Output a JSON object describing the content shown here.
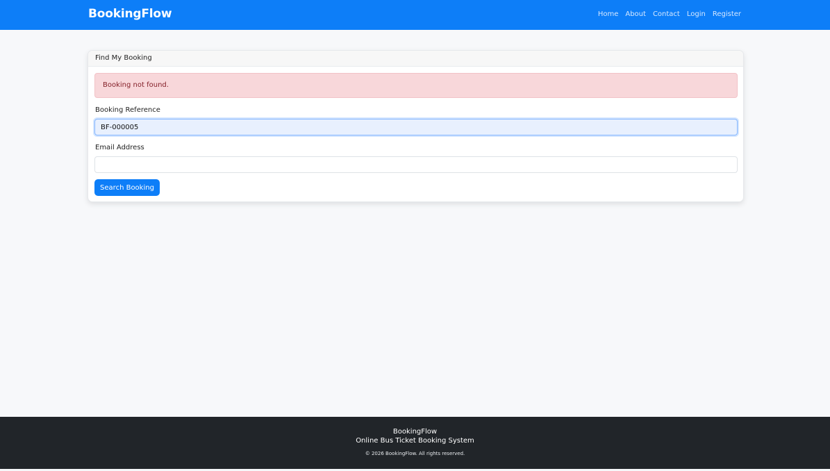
{
  "navbar": {
    "brand": "BookingFlow",
    "links": [
      "Home",
      "About",
      "Contact",
      "Login",
      "Register"
    ]
  },
  "card": {
    "header": "Find My Booking",
    "alert": "Booking not found.",
    "reference_label": "Booking Reference",
    "reference_value": "BF-000005",
    "email_label": "Email Address",
    "email_value": "",
    "search_button": "Search Booking"
  },
  "footer": {
    "brand": "BookingFlow",
    "tagline": "Online Bus Ticket Booking System",
    "copyright": "© 2026 BookingFlow. All rights reserved."
  },
  "colors": {
    "primary": "#0d7ef8",
    "alert_bg": "#f8d7da",
    "footer_bg": "#212529"
  }
}
